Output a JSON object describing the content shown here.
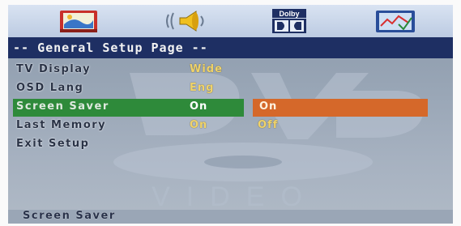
{
  "icons": [
    "picture-icon",
    "speaker-icon",
    "dolby-icon",
    "preferences-icon"
  ],
  "dolby_logo_text": "Dolby",
  "header": {
    "title": "-- General Setup Page --"
  },
  "watermark": {
    "word": "VIDEO"
  },
  "rows": [
    {
      "label": "TV Display",
      "value": "Wide"
    },
    {
      "label": "OSD Lang",
      "value": "Eng"
    },
    {
      "label": "Screen Saver",
      "value": "On",
      "option": "On"
    },
    {
      "label": "Last Memory",
      "value": "On",
      "option": "Off"
    },
    {
      "label": "Exit Setup",
      "value": ""
    }
  ],
  "status": {
    "text": "Screen Saver"
  },
  "colors": {
    "header_bg": "#1e2f63",
    "selected_row": "#2e8a3a",
    "option_highlight": "#d5682a",
    "value_text": "#f0d36a"
  }
}
